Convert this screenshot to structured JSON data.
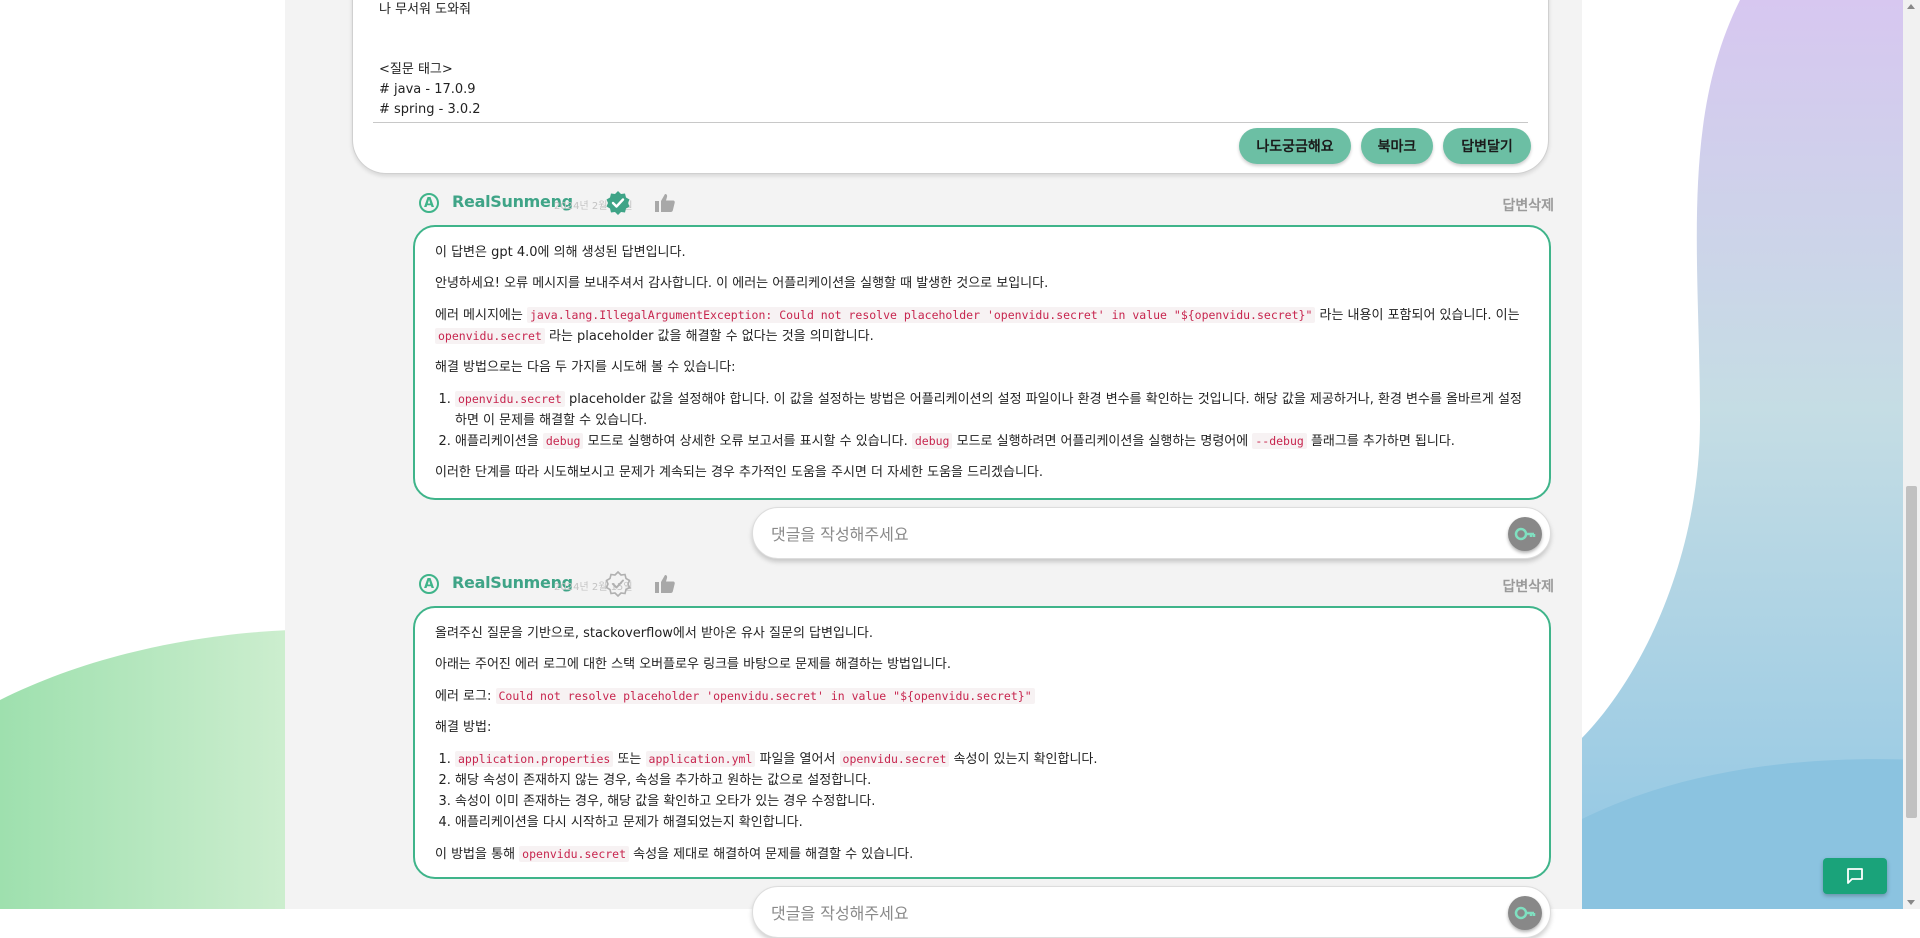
{
  "question": {
    "lines": [
      "나 무서워 도와줘",
      "",
      "",
      "<질문 태그>",
      "# java - 17.0.9",
      "# spring - 3.0.2"
    ],
    "buttons": {
      "curious": "나도궁금해요",
      "bookmark": "북마크",
      "answer": "답변달기"
    }
  },
  "answers": [
    {
      "avatar_letter": "A",
      "author": "RealSunmeng",
      "date": "2024년 2월 15일",
      "verified": true,
      "delete_label": "답변삭제",
      "p1": "이 답변은 gpt 4.0에 의해 생성된 답변입니다.",
      "p2": "안녕하세요! 오류 메시지를 보내주셔서 감사합니다. 이 에러는 어플리케이션을 실행할 때 발생한 것으로 보입니다.",
      "p3_a": "에러 메시지에는 ",
      "p3_code1": "java.lang.IllegalArgumentException: Could not resolve placeholder 'openvidu.secret' in value \"${openvidu.secret}\"",
      "p3_b": " 라는 내용이 포함되어 있습니다. 이는 ",
      "p3_code2": "openvidu.secret",
      "p3_c": " 라는 placeholder 값을 해결할 수 없다는 것을 의미합니다.",
      "p4": "해결 방법으로는 다음 두 가지를 시도해 볼 수 있습니다:",
      "li1_code": "openvidu.secret",
      "li1_text": " placeholder 값을 설정해야 합니다. 이 값을 설정하는 방법은 어플리케이션의 설정 파일이나 환경 변수를 확인하는 것입니다. 해당 값을 제공하거나, 환경 변수를 올바르게 설정하면 이 문제를 해결할 수 있습니다.",
      "li2_a": "애플리케이션을 ",
      "li2_code1": "debug",
      "li2_b": " 모드로 실행하여 상세한 오류 보고서를 표시할 수 있습니다. ",
      "li2_code2": "debug",
      "li2_c": " 모드로 실행하려면 어플리케이션을 실행하는 명령어에 ",
      "li2_code3": "--debug",
      "li2_d": " 플래그를 추가하면 됩니다.",
      "p5": "이러한 단계를 따라 시도해보시고 문제가 계속되는 경우 추가적인 도움을 주시면 더 자세한 도움을 드리겠습니다."
    },
    {
      "avatar_letter": "A",
      "author": "RealSunmeng",
      "date": "2024년 2월 15일",
      "verified": false,
      "delete_label": "답변삭제",
      "p1": "올려주신 질문을 기반으로, stackoverflow에서 받아온 유사 질문의 답변입니다.",
      "p2": "아래는 주어진 에러 로그에 대한 스택 오버플로우 링크를 바탕으로 문제를 해결하는 방법입니다.",
      "p3_a": "에러 로그: ",
      "p3_code": "Could not resolve placeholder 'openvidu.secret' in value \"${openvidu.secret}\"",
      "p4": "해결 방법:",
      "li1_code1": "application.properties",
      "li1_a": " 또는 ",
      "li1_code2": "application.yml",
      "li1_b": " 파일을 열어서 ",
      "li1_code3": "openvidu.secret",
      "li1_c": " 속성이 있는지 확인합니다.",
      "li2": "해당 속성이 존재하지 않는 경우, 속성을 추가하고 원하는 값으로 설정합니다.",
      "li3": "속성이 이미 존재하는 경우, 해당 값을 확인하고 오타가 있는 경우 수정합니다.",
      "li4": "애플리케이션을 다시 시작하고 문제가 해결되었는지 확인합니다.",
      "p5_a": "이 방법을 통해 ",
      "p5_code": "openvidu.secret",
      "p5_b": " 속성을 제대로 해결하여 문제를 해결할 수 있습니다."
    }
  ],
  "comment": {
    "placeholder": "댓글을 작성해주세요"
  },
  "colors": {
    "accent": "#3fb48a",
    "button": "#6cbfa4",
    "fab": "#1aa37a"
  }
}
